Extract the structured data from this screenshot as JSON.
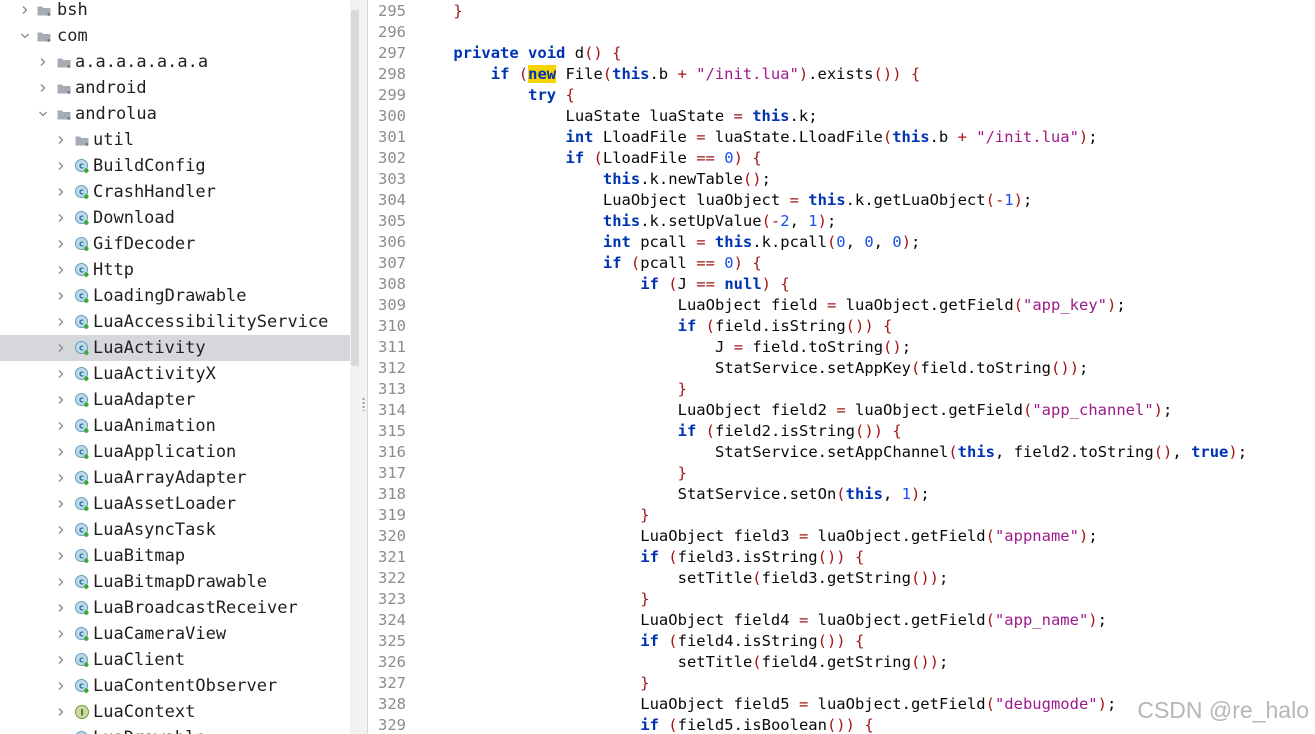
{
  "tree": {
    "selected_index": 13,
    "items": [
      {
        "label": "bsh",
        "type": "folder",
        "indent": 0,
        "expanded": false
      },
      {
        "label": "com",
        "type": "folder",
        "indent": 0,
        "expanded": true
      },
      {
        "label": "a.a.a.a.a.a.a",
        "type": "folder",
        "indent": 1,
        "expanded": false
      },
      {
        "label": "android",
        "type": "folder",
        "indent": 1,
        "expanded": false
      },
      {
        "label": "androlua",
        "type": "folder",
        "indent": 1,
        "expanded": true
      },
      {
        "label": "util",
        "type": "folder",
        "indent": 2,
        "expanded": false
      },
      {
        "label": "BuildConfig",
        "type": "class",
        "indent": 2,
        "expanded": false
      },
      {
        "label": "CrashHandler",
        "type": "class",
        "indent": 2,
        "expanded": false
      },
      {
        "label": "Download",
        "type": "class",
        "indent": 2,
        "expanded": false
      },
      {
        "label": "GifDecoder",
        "type": "class",
        "indent": 2,
        "expanded": false
      },
      {
        "label": "Http",
        "type": "class",
        "indent": 2,
        "expanded": false
      },
      {
        "label": "LoadingDrawable",
        "type": "class",
        "indent": 2,
        "expanded": false
      },
      {
        "label": "LuaAccessibilityService",
        "type": "class",
        "indent": 2,
        "expanded": false
      },
      {
        "label": "LuaActivity",
        "type": "class",
        "indent": 2,
        "expanded": false
      },
      {
        "label": "LuaActivityX",
        "type": "class",
        "indent": 2,
        "expanded": false
      },
      {
        "label": "LuaAdapter",
        "type": "class",
        "indent": 2,
        "expanded": false
      },
      {
        "label": "LuaAnimation",
        "type": "class",
        "indent": 2,
        "expanded": false
      },
      {
        "label": "LuaApplication",
        "type": "class",
        "indent": 2,
        "expanded": false
      },
      {
        "label": "LuaArrayAdapter",
        "type": "class",
        "indent": 2,
        "expanded": false
      },
      {
        "label": "LuaAssetLoader",
        "type": "class",
        "indent": 2,
        "expanded": false
      },
      {
        "label": "LuaAsyncTask",
        "type": "class",
        "indent": 2,
        "expanded": false
      },
      {
        "label": "LuaBitmap",
        "type": "class",
        "indent": 2,
        "expanded": false
      },
      {
        "label": "LuaBitmapDrawable",
        "type": "class",
        "indent": 2,
        "expanded": false
      },
      {
        "label": "LuaBroadcastReceiver",
        "type": "class",
        "indent": 2,
        "expanded": false
      },
      {
        "label": "LuaCameraView",
        "type": "class",
        "indent": 2,
        "expanded": false
      },
      {
        "label": "LuaClient",
        "type": "class",
        "indent": 2,
        "expanded": false
      },
      {
        "label": "LuaContentObserver",
        "type": "class",
        "indent": 2,
        "expanded": false
      },
      {
        "label": "LuaContext",
        "type": "interface",
        "indent": 2,
        "expanded": false
      },
      {
        "label": "LuaDrawable",
        "type": "class",
        "indent": 2,
        "expanded": false
      }
    ]
  },
  "editor": {
    "lines": [
      {
        "n": "295",
        "text": "    }"
      },
      {
        "n": "296",
        "text": ""
      },
      {
        "n": "297",
        "text": "    private void d() {"
      },
      {
        "n": "298",
        "text": "        if (new File(this.b + \"/init.lua\").exists()) {"
      },
      {
        "n": "299",
        "text": "            try {"
      },
      {
        "n": "300",
        "text": "                LuaState luaState = this.k;"
      },
      {
        "n": "301",
        "text": "                int LloadFile = luaState.LloadFile(this.b + \"/init.lua\");"
      },
      {
        "n": "302",
        "text": "                if (LloadFile == 0) {"
      },
      {
        "n": "303",
        "text": "                    this.k.newTable();"
      },
      {
        "n": "304",
        "text": "                    LuaObject luaObject = this.k.getLuaObject(-1);"
      },
      {
        "n": "305",
        "text": "                    this.k.setUpValue(-2, 1);"
      },
      {
        "n": "306",
        "text": "                    int pcall = this.k.pcall(0, 0, 0);"
      },
      {
        "n": "307",
        "text": "                    if (pcall == 0) {"
      },
      {
        "n": "308",
        "text": "                        if (J == null) {"
      },
      {
        "n": "309",
        "text": "                            LuaObject field = luaObject.getField(\"app_key\");"
      },
      {
        "n": "310",
        "text": "                            if (field.isString()) {"
      },
      {
        "n": "311",
        "text": "                                J = field.toString();"
      },
      {
        "n": "312",
        "text": "                                StatService.setAppKey(field.toString());"
      },
      {
        "n": "313",
        "text": "                            }"
      },
      {
        "n": "314",
        "text": "                            LuaObject field2 = luaObject.getField(\"app_channel\");"
      },
      {
        "n": "315",
        "text": "                            if (field2.isString()) {"
      },
      {
        "n": "316",
        "text": "                                StatService.setAppChannel(this, field2.toString(), true);"
      },
      {
        "n": "317",
        "text": "                            }"
      },
      {
        "n": "318",
        "text": "                            StatService.setOn(this, 1);"
      },
      {
        "n": "319",
        "text": "                        }"
      },
      {
        "n": "320",
        "text": "                        LuaObject field3 = luaObject.getField(\"appname\");"
      },
      {
        "n": "321",
        "text": "                        if (field3.isString()) {"
      },
      {
        "n": "322",
        "text": "                            setTitle(field3.getString());"
      },
      {
        "n": "323",
        "text": "                        }"
      },
      {
        "n": "324",
        "text": "                        LuaObject field4 = luaObject.getField(\"app_name\");"
      },
      {
        "n": "325",
        "text": "                        if (field4.isString()) {"
      },
      {
        "n": "326",
        "text": "                            setTitle(field4.getString());"
      },
      {
        "n": "327",
        "text": "                        }"
      },
      {
        "n": "328",
        "text": "                        LuaObject field5 = luaObject.getField(\"debugmode\");"
      },
      {
        "n": "329",
        "text": "                        if (field5.isBoolean()) {"
      }
    ],
    "highlighted_keyword": "new"
  },
  "watermark": "CSDN @re_halo",
  "colors": {
    "keyword": "#0033b3",
    "string": "#9c1a8a",
    "number": "#1750eb",
    "symbol": "#a31515",
    "highlight": "#f5d400",
    "selection": "#d5d7db"
  }
}
